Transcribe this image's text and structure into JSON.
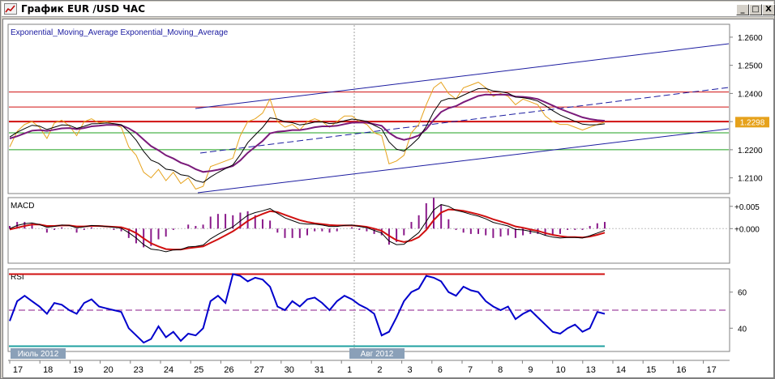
{
  "window": {
    "title": "График EUR /USD ЧАС",
    "buttons": {
      "minimize": "_",
      "maximize": "□",
      "close": "X"
    }
  },
  "colors": {
    "price": "#e6a21c",
    "ema_fast": "#000000",
    "ema_slow": "#7a1a7a",
    "channel": "#1c1ca0",
    "resistance": "#d01010",
    "support": "#1fa01f",
    "macd_line": "#000000",
    "macd_signal": "#d01010",
    "macd_hist": "#8a1a8a",
    "rsi_line": "#0000cc",
    "rsi_upper": "#d01010",
    "rsi_lower": "#20a0a0",
    "rsi_mid": "#8a1a8a",
    "price_label_bg": "#e6a21c"
  },
  "chart_data": [
    {
      "type": "line",
      "panel": "price",
      "title": "Exponential_Moving_Average Exponential_Moving_Average",
      "ylim": [
        1.205,
        1.264
      ],
      "y_ticks": [
        "1.2600",
        "1.2500",
        "1.2400",
        "1.2300",
        "1.2200",
        "1.2100"
      ],
      "y_tick_values": [
        1.26,
        1.25,
        1.24,
        1.23,
        1.22,
        1.21
      ],
      "current_price": "1.2298",
      "current_price_value": 1.2298,
      "x": [
        0,
        1,
        2,
        3,
        4,
        5,
        6,
        7,
        8,
        9,
        10,
        11,
        12,
        13,
        14,
        15,
        16,
        17,
        18,
        19,
        20,
        21,
        22,
        23,
        24,
        25,
        26,
        27,
        28,
        29,
        30,
        31,
        32,
        33,
        34,
        35,
        36,
        37,
        38,
        39,
        40,
        41,
        42,
        43,
        44,
        45,
        46,
        47,
        48,
        49,
        50,
        51,
        52,
        53,
        54,
        55,
        56,
        57,
        58,
        59,
        60,
        61,
        62,
        63,
        64,
        65,
        66,
        67,
        68,
        69,
        70,
        71,
        72,
        73,
        74,
        75,
        76,
        77,
        78,
        79,
        80
      ],
      "series": [
        {
          "name": "price",
          "values": [
            1.221,
            1.2265,
            1.229,
            1.23,
            1.228,
            1.224,
            1.2295,
            1.2305,
            1.2285,
            1.225,
            1.23,
            1.231,
            1.2295,
            1.23,
            1.229,
            1.228,
            1.221,
            1.218,
            1.212,
            1.21,
            1.213,
            1.209,
            1.212,
            1.208,
            1.21,
            1.206,
            1.207,
            1.214,
            1.215,
            1.216,
            1.217,
            1.225,
            1.23,
            1.231,
            1.233,
            1.238,
            1.23,
            1.228,
            1.229,
            1.227,
            1.23,
            1.231,
            1.23,
            1.228,
            1.23,
            1.232,
            1.232,
            1.23,
            1.229,
            1.226,
            1.225,
            1.215,
            1.216,
            1.218,
            1.226,
            1.229,
            1.236,
            1.242,
            1.244,
            1.24,
            1.238,
            1.242,
            1.243,
            1.244,
            1.242,
            1.239,
            1.24,
            1.239,
            1.236,
            1.238,
            1.237,
            1.236,
            1.232,
            1.23,
            1.229,
            1.229,
            1.228,
            1.227,
            1.228,
            1.229,
            1.2298
          ]
        },
        {
          "name": "ema_fast",
          "values": [
            1.2245,
            1.2262,
            1.2275,
            1.2287,
            1.2284,
            1.2272,
            1.228,
            1.2288,
            1.2287,
            1.2276,
            1.2283,
            1.2292,
            1.2293,
            1.2295,
            1.2293,
            1.2289,
            1.2264,
            1.2234,
            1.2194,
            1.2163,
            1.2152,
            1.2131,
            1.2127,
            1.2111,
            1.2107,
            1.2091,
            1.2084,
            1.2103,
            1.2119,
            1.2133,
            1.2146,
            1.2182,
            1.2225,
            1.2253,
            1.2279,
            1.2313,
            1.2309,
            1.2299,
            1.2296,
            1.2288,
            1.2292,
            1.2298,
            1.2299,
            1.2293,
            1.2295,
            1.2303,
            1.2309,
            1.2306,
            1.2301,
            1.2287,
            1.2274,
            1.2228,
            1.2202,
            1.2195,
            1.2217,
            1.2242,
            1.2283,
            1.2335,
            1.2373,
            1.2382,
            1.2381,
            1.2394,
            1.2406,
            1.2417,
            1.2418,
            1.2409,
            1.2406,
            1.2401,
            1.2387,
            1.2385,
            1.238,
            1.2373,
            1.2357,
            1.2339,
            1.2323,
            1.2312,
            1.2301,
            1.2291,
            1.2288,
            1.2289,
            1.2292
          ]
        },
        {
          "name": "ema_slow",
          "values": [
            1.224,
            1.2248,
            1.2258,
            1.2268,
            1.227,
            1.2267,
            1.2271,
            1.2276,
            1.2277,
            1.2273,
            1.2277,
            1.2283,
            1.2285,
            1.2288,
            1.2288,
            1.2287,
            1.2276,
            1.226,
            1.2236,
            1.2213,
            1.2198,
            1.218,
            1.2169,
            1.2154,
            1.2145,
            1.2131,
            1.2121,
            1.2124,
            1.2129,
            1.2135,
            1.2142,
            1.2162,
            1.2189,
            1.221,
            1.2231,
            1.2258,
            1.2264,
            1.2266,
            1.227,
            1.227,
            1.2274,
            1.228,
            1.2283,
            1.2283,
            1.2285,
            1.2291,
            1.2296,
            1.2297,
            1.2296,
            1.2291,
            1.2285,
            1.226,
            1.2243,
            1.2235,
            1.2241,
            1.2251,
            1.2273,
            1.2306,
            1.2334,
            1.2348,
            1.2355,
            1.2369,
            1.238,
            1.2391,
            1.2396,
            1.2395,
            1.2396,
            1.2395,
            1.2389,
            1.2388,
            1.2385,
            1.238,
            1.2369,
            1.2357,
            1.2345,
            1.2335,
            1.2325,
            1.2315,
            1.2309,
            1.2305,
            1.2303
          ]
        }
      ],
      "hlines": [
        {
          "name": "resistance-1",
          "value": 1.2405,
          "color": "#d01010"
        },
        {
          "name": "resistance-2",
          "value": 1.2352,
          "color": "#d01010"
        },
        {
          "name": "resistance-3",
          "value": 1.23,
          "color": "#d01010"
        },
        {
          "name": "support-1",
          "value": 1.226,
          "color": "#1fa01f"
        },
        {
          "name": "support-2",
          "value": 1.22,
          "color": "#1fa01f"
        }
      ]
    },
    {
      "type": "line",
      "panel": "macd",
      "title": "MACD",
      "ylim": [
        -0.0074,
        0.0066
      ],
      "y_ticks": [
        "+0.005",
        "+0.000"
      ],
      "y_tick_values": [
        0.005,
        0.0
      ],
      "x": [
        0,
        1,
        2,
        3,
        4,
        5,
        6,
        7,
        8,
        9,
        10,
        11,
        12,
        13,
        14,
        15,
        16,
        17,
        18,
        19,
        20,
        21,
        22,
        23,
        24,
        25,
        26,
        27,
        28,
        29,
        30,
        31,
        32,
        33,
        34,
        35,
        36,
        37,
        38,
        39,
        40,
        41,
        42,
        43,
        44,
        45,
        46,
        47,
        48,
        49,
        50,
        51,
        52,
        53,
        54,
        55,
        56,
        57,
        58,
        59,
        60,
        61,
        62,
        63,
        64,
        65,
        66,
        67,
        68,
        69,
        70,
        71,
        72,
        73,
        74,
        75,
        76,
        77,
        78,
        79,
        80
      ],
      "series": [
        {
          "name": "macd",
          "values": [
            0.0,
            0.0007,
            0.0011,
            0.0013,
            0.0009,
            0.0003,
            0.0005,
            0.0008,
            0.0007,
            0.0002,
            0.0004,
            0.0007,
            0.0006,
            0.0005,
            0.0003,
            0.0001,
            -0.0009,
            -0.0021,
            -0.0036,
            -0.0046,
            -0.0048,
            -0.0052,
            -0.0048,
            -0.0047,
            -0.0041,
            -0.004,
            -0.0037,
            -0.0023,
            -0.0013,
            -0.0004,
            0.0004,
            0.0017,
            0.003,
            0.0036,
            0.004,
            0.0045,
            0.0034,
            0.0024,
            0.0018,
            0.0012,
            0.001,
            0.001,
            0.0008,
            0.0005,
            0.0005,
            0.0007,
            0.0008,
            0.0005,
            0.0002,
            -0.0004,
            -0.001,
            -0.0028,
            -0.0036,
            -0.0035,
            -0.0022,
            -0.0009,
            0.0016,
            0.0042,
            0.0054,
            0.005,
            0.0041,
            0.0037,
            0.0032,
            0.0028,
            0.0022,
            0.0014,
            0.001,
            0.0006,
            -0.0002,
            -0.0003,
            -0.0006,
            -0.0009,
            -0.0015,
            -0.0019,
            -0.0021,
            -0.002,
            -0.002,
            -0.0021,
            -0.0016,
            -0.001,
            -0.0004
          ]
        },
        {
          "name": "signal",
          "values": [
            -0.0002,
            0.0002,
            0.0006,
            0.0009,
            0.0009,
            0.0006,
            0.0006,
            0.0007,
            0.0007,
            0.0005,
            0.0005,
            0.0006,
            0.0006,
            0.0005,
            0.0004,
            0.0003,
            -0.0002,
            -0.001,
            -0.0022,
            -0.0033,
            -0.004,
            -0.0046,
            -0.0047,
            -0.0047,
            -0.0044,
            -0.0042,
            -0.004,
            -0.0032,
            -0.0024,
            -0.0015,
            -0.0006,
            0.0005,
            0.0017,
            0.0026,
            0.0033,
            0.0039,
            0.0037,
            0.0031,
            0.0025,
            0.0019,
            0.0015,
            0.0012,
            0.001,
            0.0008,
            0.0007,
            0.0007,
            0.0007,
            0.0006,
            0.0004,
            0.0,
            -0.0005,
            -0.0016,
            -0.0026,
            -0.003,
            -0.0027,
            -0.0019,
            -0.0003,
            0.0019,
            0.0036,
            0.0043,
            0.0042,
            0.004,
            0.0036,
            0.0032,
            0.0027,
            0.0021,
            0.0016,
            0.0011,
            0.0005,
            0.0002,
            -0.0002,
            -0.0005,
            -0.001,
            -0.0014,
            -0.0017,
            -0.0019,
            -0.0019,
            -0.002,
            -0.0018,
            -0.0014,
            -0.0009
          ]
        }
      ]
    },
    {
      "type": "line",
      "panel": "rsi",
      "title": "RSI",
      "ylim": [
        28,
        72
      ],
      "y_ticks": [
        "60",
        "40"
      ],
      "y_tick_values": [
        60,
        40
      ],
      "levels": {
        "upper": 70,
        "middle": 50,
        "lower": 30
      },
      "x": [
        0,
        1,
        2,
        3,
        4,
        5,
        6,
        7,
        8,
        9,
        10,
        11,
        12,
        13,
        14,
        15,
        16,
        17,
        18,
        19,
        20,
        21,
        22,
        23,
        24,
        25,
        26,
        27,
        28,
        29,
        30,
        31,
        32,
        33,
        34,
        35,
        36,
        37,
        38,
        39,
        40,
        41,
        42,
        43,
        44,
        45,
        46,
        47,
        48,
        49,
        50,
        51,
        52,
        53,
        54,
        55,
        56,
        57,
        58,
        59,
        60,
        61,
        62,
        63,
        64,
        65,
        66,
        67,
        68,
        69,
        70,
        71,
        72,
        73,
        74,
        75,
        76,
        77,
        78,
        79,
        80
      ],
      "series": [
        {
          "name": "rsi",
          "values": [
            44,
            55,
            58,
            55,
            52,
            48,
            54,
            53,
            50,
            48,
            54,
            56,
            52,
            51,
            50,
            49,
            40,
            36,
            32,
            34,
            41,
            35,
            38,
            33,
            37,
            36,
            40,
            55,
            58,
            54,
            70,
            69,
            66,
            68,
            67,
            63,
            52,
            50,
            55,
            52,
            56,
            57,
            54,
            50,
            55,
            58,
            56,
            53,
            51,
            48,
            36,
            38,
            46,
            55,
            60,
            62,
            69,
            68,
            66,
            60,
            58,
            63,
            61,
            60,
            55,
            52,
            50,
            52,
            45,
            48,
            50,
            46,
            42,
            38,
            37,
            40,
            42,
            38,
            40,
            49,
            48
          ]
        }
      ]
    }
  ],
  "x_axis": {
    "labels": [
      "17",
      "18",
      "19",
      "20",
      "23",
      "24",
      "25",
      "26",
      "27",
      "30",
      "31",
      "1",
      "2",
      "3",
      "6",
      "7",
      "8",
      "9",
      "10",
      "13",
      "14",
      "15",
      "16",
      "17"
    ],
    "month_labels": [
      "Июль 2012",
      "Авг 2012"
    ]
  }
}
